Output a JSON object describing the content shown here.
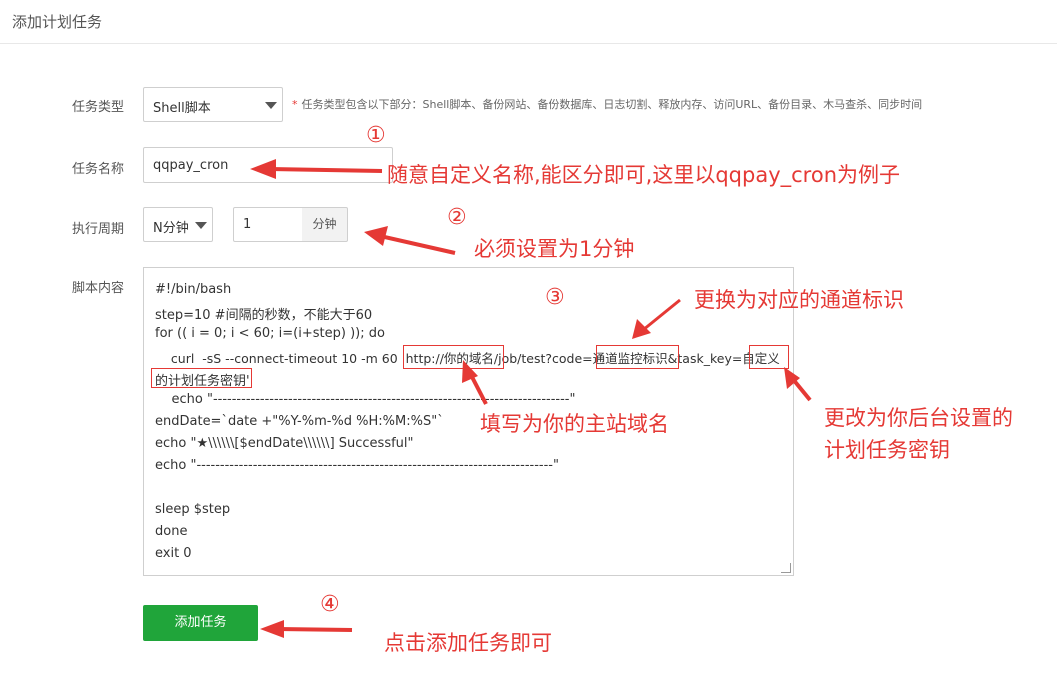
{
  "header": {
    "title": "添加计划任务"
  },
  "form": {
    "task_type_label": "任务类型",
    "task_type_value": "Shell脚本",
    "task_type_hint_star": "*",
    "task_type_hint": "任务类型包含以下部分：Shell脚本、备份网站、备份数据库、日志切割、释放内存、访问URL、备份目录、木马查杀、同步时间",
    "task_name_label": "任务名称",
    "task_name_value": "qqpay_cron",
    "period_label": "执行周期",
    "period_unit_select": "N分钟",
    "period_value": "1",
    "period_unit": "分钟",
    "script_label": "脚本内容",
    "script_lines": [
      "#!/bin/bash",
      "step=10 #间隔的秒数，不能大于60",
      "for (( i = 0; i < 60; i=(i+step) )); do",
      "    curl  -sS --connect-timeout 10 -m 60  http://你的域名/job/test?code=通道监控标识&task_key=自定义",
      "的计划任务密钥'",
      "    echo \"----------------------------------------------------------------------------\"",
      "endDate=`date +\"%Y-%m-%d %H:%M:%S\"`",
      "echo \"★\\\\\\\\\\\\[$endDate\\\\\\\\\\\\] Successful\"",
      "echo \"----------------------------------------------------------------------------\"",
      "",
      "sleep $step",
      "done",
      "exit 0"
    ],
    "submit_label": "添加任务"
  },
  "annotations": {
    "n1": "①",
    "n2": "②",
    "n3": "③",
    "n4": "④",
    "a1": "随意自定义名称,能区分即可,这里以qqpay_cron为例子",
    "a2": "必须设置为1分钟",
    "a3": "更换为对应的通道标识",
    "a4": "填写为你的主站域名",
    "a5_line1": "更改为你后台设置的",
    "a5_line2": "计划任务密钥",
    "a6": "点击添加任务即可"
  },
  "colors": {
    "primary_button": "#20a53a",
    "annotation": "#e53935"
  }
}
